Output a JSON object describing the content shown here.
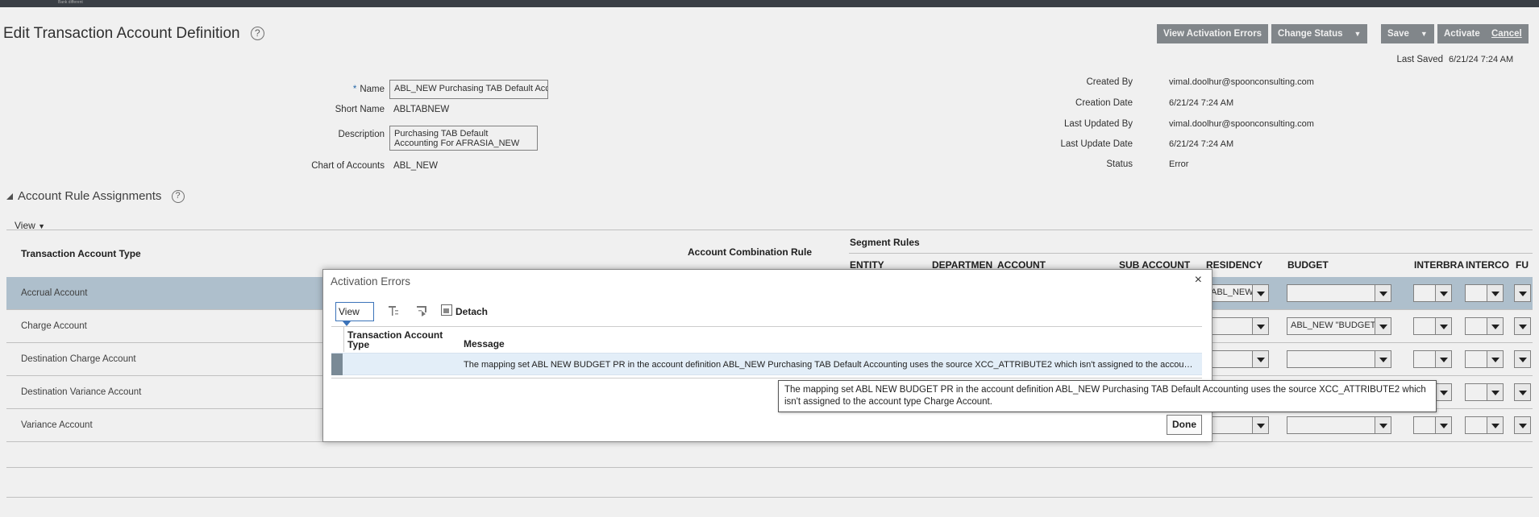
{
  "brand": "Bank different",
  "page": {
    "title": "Edit Transaction Account Definition",
    "help": "?"
  },
  "toolbar": {
    "view_errors": "View Activation Errors",
    "change_status": "Change Status",
    "save": "Save",
    "activate": "Activate",
    "cancel": "Cancel"
  },
  "last_saved": {
    "label": "Last Saved",
    "value": "6/21/24 7:24 AM"
  },
  "form": {
    "required_marker": "*",
    "name_label": "Name",
    "name_value": "ABL_NEW Purchasing TAB Default Accounting For AFRASIA_NEW",
    "short_name_label": "Short Name",
    "short_name_value": "ABLTABNEW",
    "description_label": "Description",
    "description_value": "Purchasing TAB Default Accounting For AFRASIA_NEW",
    "coa_label": "Chart of Accounts",
    "coa_value": "ABL_NEW"
  },
  "info": {
    "created_by_label": "Created By",
    "created_by_value": "vimal.doolhur@spoonconsulting.com",
    "creation_date_label": "Creation Date",
    "creation_date_value": "6/21/24 7:24 AM",
    "last_updated_by_label": "Last Updated By",
    "last_updated_by_value": "vimal.doolhur@spoonconsulting.com",
    "last_update_date_label": "Last Update Date",
    "last_update_date_value": "6/21/24 7:24 AM",
    "status_label": "Status",
    "status_value": "Error"
  },
  "assignments": {
    "section_title": "Account Rule Assignments",
    "view_label": "View",
    "columns": {
      "type": "Transaction Account Type",
      "combination_rule": "Account Combination Rule",
      "segment_rules": "Segment Rules",
      "entity": "ENTITY",
      "department": "DEPARTMEN",
      "account": "ACCOUNT",
      "sub_account": "SUB ACCOUNT",
      "residency": "RESIDENCY",
      "budget": "BUDGET",
      "interbank": "INTERBRA",
      "intercompany": "INTERCO",
      "future": "FU"
    },
    "rows": [
      {
        "type": "Accrual Account",
        "residency": "ABL_NEW",
        "budget": ""
      },
      {
        "type": "Charge Account",
        "residency": "",
        "budget": "ABL_NEW \"BUDGET"
      },
      {
        "type": "Destination Charge Account",
        "residency": "",
        "budget": ""
      },
      {
        "type": "Destination Variance Account",
        "residency": "",
        "budget": ""
      },
      {
        "type": "Variance Account",
        "residency": "",
        "budget": ""
      }
    ]
  },
  "dialog": {
    "title": "Activation Errors",
    "close": "×",
    "view": "View",
    "detach": "Detach",
    "col_type": "Transaction Account Type",
    "col_message": "Message",
    "rows": [
      {
        "type": "",
        "message": "The mapping set ABL NEW BUDGET PR in the account definition ABL_NEW Purchasing TAB Default Accounting uses the source XCC_ATTRIBUTE2 which isn't assigned to the account type Charge Account."
      }
    ],
    "done": "Done",
    "tooltip": "The mapping set ABL NEW BUDGET PR in the account definition ABL_NEW Purchasing TAB Default Accounting uses the source XCC_ATTRIBUTE2 which isn't assigned to the account type Charge Account."
  }
}
